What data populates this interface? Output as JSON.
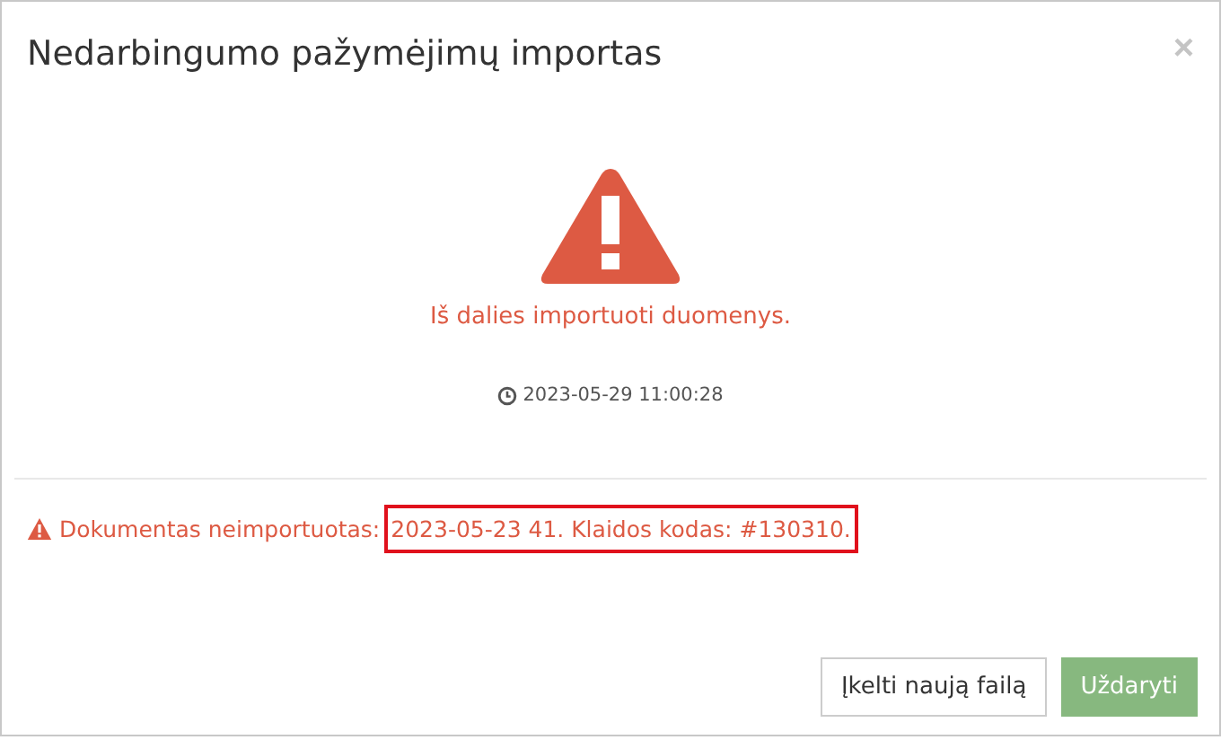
{
  "dialog": {
    "title": "Nedarbingumo pažymėjimų importas",
    "close": "×"
  },
  "result": {
    "status": "Iš dalies importuoti duomenys.",
    "timestamp": "2023-05-29 11:00:28"
  },
  "errors": [
    {
      "label": "Dokumentas neimportuotas:",
      "detail": "2023-05-23 41. Klaidos kodas: #130310.",
      "highlighted": true
    }
  ],
  "buttons": [
    {
      "label": "Įkelti naują failą",
      "kind": "default"
    },
    {
      "label": "Uždaryti",
      "kind": "primary"
    }
  ]
}
